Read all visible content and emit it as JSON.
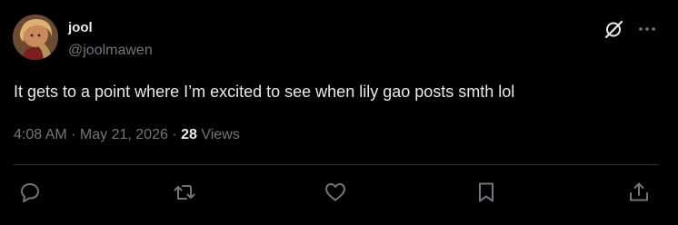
{
  "author": {
    "display_name": "jool",
    "handle": "@joolmawen",
    "avatar": "avatar-portrait"
  },
  "tweet": {
    "text": "It gets to a point where I’m excited to see when lily gao posts smth lol",
    "time": "4:08 AM",
    "separator1": " · ",
    "date": "May 21, 2026",
    "separator2": " · ",
    "views_count": "28",
    "views_label": " Views"
  },
  "header_icons": [
    "grok-icon",
    "more-icon"
  ],
  "actions": [
    "reply-icon",
    "retweet-icon",
    "like-icon",
    "bookmark-icon",
    "share-icon"
  ],
  "colors": {
    "background": "#000000",
    "primary_text": "#e7e9ea",
    "secondary_text": "#71767b",
    "divider": "#2f3336"
  }
}
